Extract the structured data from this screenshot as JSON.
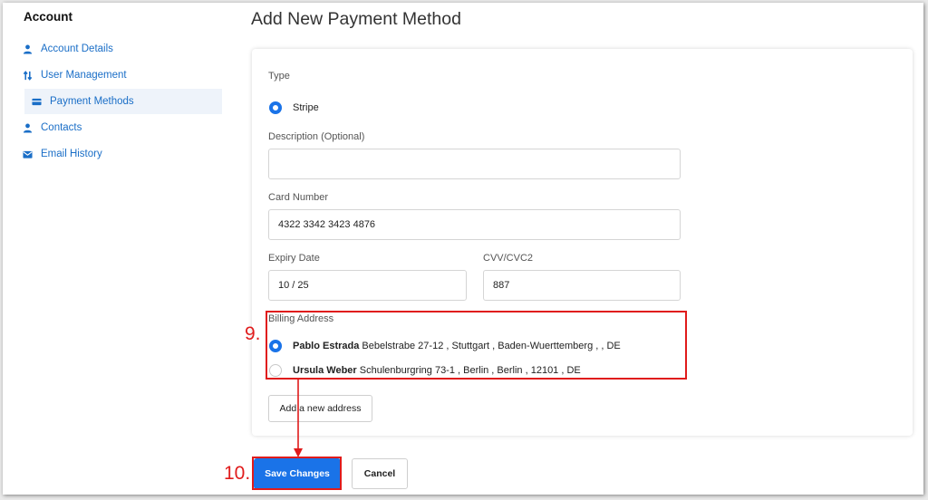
{
  "sidebar": {
    "title": "Account",
    "items": [
      {
        "label": "Account Details",
        "icon": "person-icon"
      },
      {
        "label": "User Management",
        "icon": "swap-arrows-icon"
      },
      {
        "label": "Payment Methods",
        "icon": "credit-card-icon"
      },
      {
        "label": "Contacts",
        "icon": "person-icon"
      },
      {
        "label": "Email History",
        "icon": "envelope-icon"
      }
    ]
  },
  "page": {
    "title": "Add New Payment Method"
  },
  "form": {
    "type_label": "Type",
    "type_option": "Stripe",
    "description_label": "Description (Optional)",
    "description_value": "",
    "card_number_label": "Card Number",
    "card_number_value": "4322 3342 3423 4876",
    "expiry_label": "Expiry Date",
    "expiry_value": "10 / 25",
    "cvv_label": "CVV/CVC2",
    "cvv_value": "887",
    "billing_label": "Billing Address",
    "addresses": [
      {
        "name": "Pablo Estrada",
        "address": "Bebelstrabe 27-12 , Stuttgart , Baden-Wuerttemberg ,  , DE",
        "selected": true
      },
      {
        "name": "Ursula Weber",
        "address": "Schulenburgring 73-1 , Berlin , Berlin , 12101 , DE",
        "selected": false
      }
    ],
    "add_address_label": "Add a new address"
  },
  "actions": {
    "save_label": "Save Changes",
    "cancel_label": "Cancel"
  },
  "annotations": {
    "step9": "9.",
    "step10": "10."
  },
  "colors": {
    "accent": "#1a73e8",
    "annotation": "#e01b1b",
    "link": "#1a6ec7"
  }
}
